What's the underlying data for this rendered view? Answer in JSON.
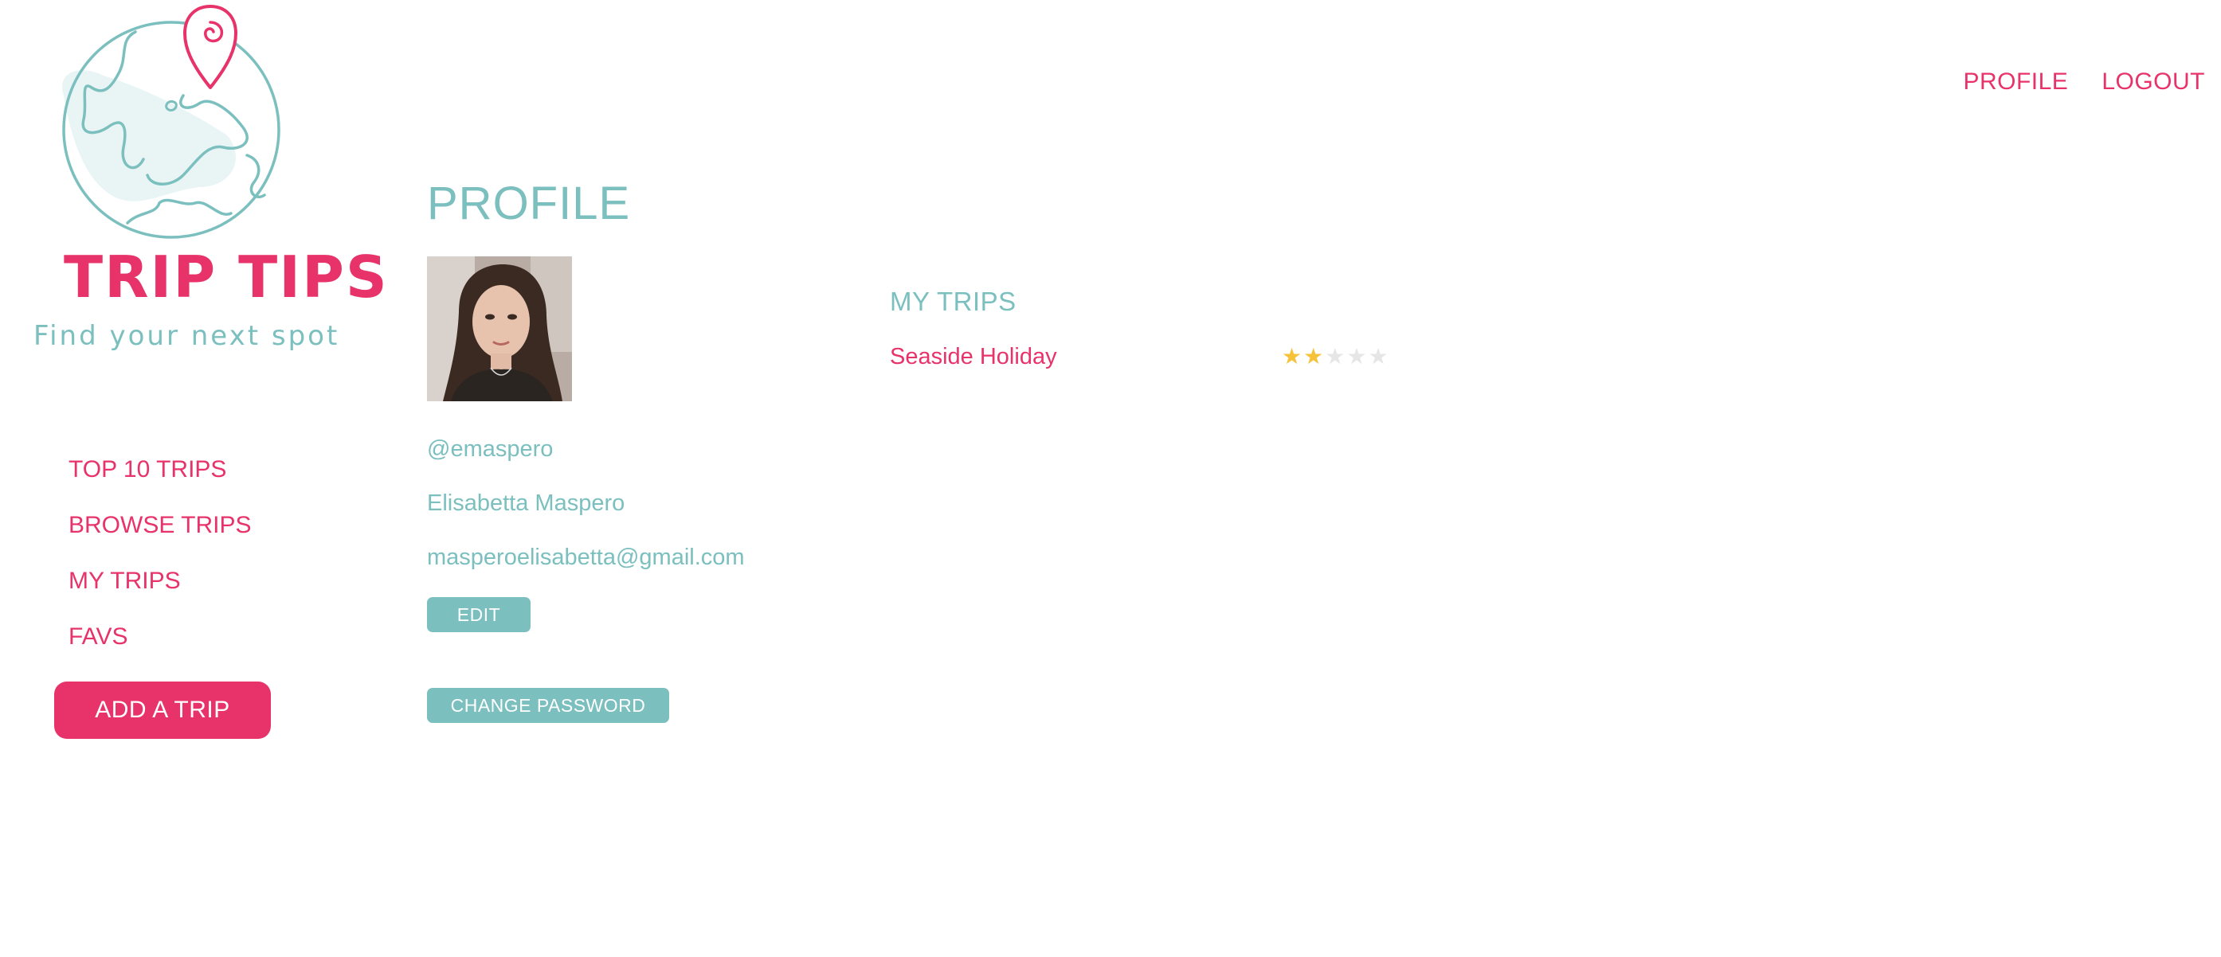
{
  "brand": {
    "title": "TRIP TIPS",
    "tagline": "Find your next spot"
  },
  "top_nav": {
    "profile": "PROFILE",
    "logout": "LOGOUT"
  },
  "sidebar": {
    "items": [
      {
        "label": "TOP 10 TRIPS"
      },
      {
        "label": "BROWSE TRIPS"
      },
      {
        "label": "MY TRIPS"
      },
      {
        "label": "FAVS"
      }
    ],
    "add_trip_label": "ADD A TRIP"
  },
  "profile": {
    "title": "PROFILE",
    "username": "@emaspero",
    "full_name": "Elisabetta Maspero",
    "email": "masperoelisabetta@gmail.com",
    "edit_label": "EDIT",
    "change_password_label": "CHANGE PASSWORD"
  },
  "my_trips": {
    "heading": "MY TRIPS",
    "trips": [
      {
        "name": "Seaside Holiday",
        "rating": 2,
        "max_rating": 5
      }
    ]
  },
  "icons": {
    "logo": "globe-with-map-pin-icon",
    "rating_star": "star-icon"
  },
  "colors": {
    "accent_pink": "#e8336a",
    "teal": "#7bbfbf",
    "star_filled": "#f6c23a",
    "star_empty": "#e6e6e6"
  }
}
